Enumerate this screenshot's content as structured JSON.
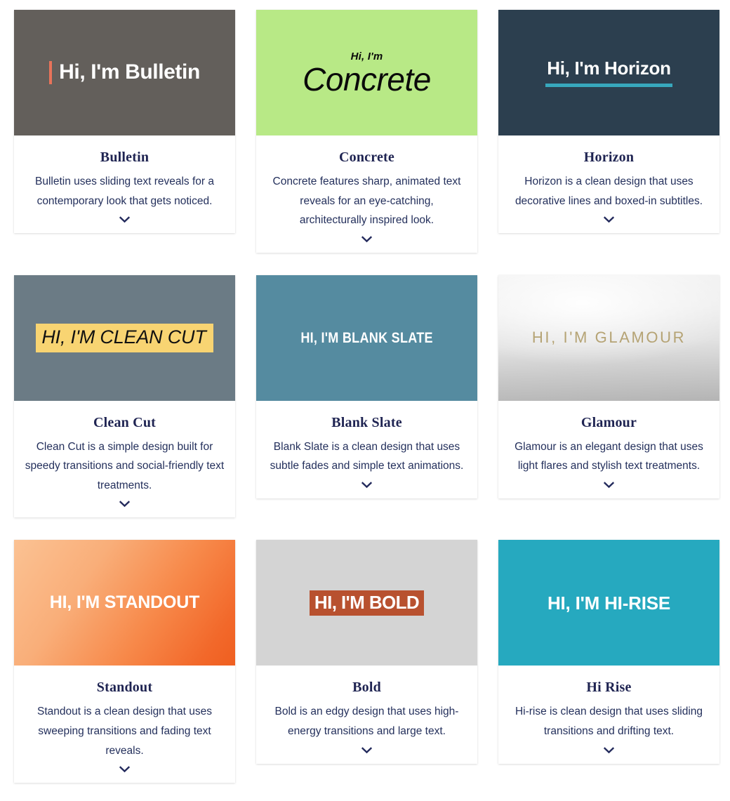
{
  "page": {
    "background_color": "#ffffff",
    "title_color": "#1f2452",
    "description_color": "#24305c"
  },
  "icons": {
    "expand_chevron": "chevron-down-icon"
  },
  "themes": [
    {
      "id": "bulletin",
      "preview_text": "Hi, I'm Bulletin",
      "preview_bg": "#635f5b",
      "preview_accent": "#e8735a",
      "title": "Bulletin",
      "description": "Bulletin uses sliding text reveals for a contemporary look that gets noticed."
    },
    {
      "id": "concrete",
      "preview_text_small": "Hi, I'm",
      "preview_text": "Concrete",
      "preview_bg": "#b8e986",
      "preview_accent": "#0a0a0a",
      "title": "Concrete",
      "description": "Concrete features sharp, animated text reveals for an eye-catching, architecturally inspired look."
    },
    {
      "id": "horizon",
      "preview_text": "Hi, I'm Horizon",
      "preview_bg": "#2c3f4f",
      "preview_accent": "#37a8bd",
      "title": "Horizon",
      "description": "Horizon is a clean design that uses decorative lines and boxed-in subtitles."
    },
    {
      "id": "clean-cut",
      "preview_text": "HI, I'M CLEAN CUT",
      "preview_bg": "#6b7b85",
      "preview_accent": "#f8d472",
      "title": "Clean Cut",
      "description": "Clean Cut is a simple design built for speedy transitions and social-friendly text treatments."
    },
    {
      "id": "blank-slate",
      "preview_text": "HI, I'M BLANK SLATE",
      "preview_bg": "#558ba0",
      "preview_accent": "#ffffff",
      "title": "Blank Slate",
      "description": "Blank Slate is a clean design that uses subtle fades and simple text animations."
    },
    {
      "id": "glamour",
      "preview_text": "HI, I'M GLAMOUR",
      "preview_bg": "#e4e4e4",
      "preview_accent": "#b5a374",
      "title": "Glamour",
      "description": "Glamour is an elegant design that uses light flares and stylish text treatments."
    },
    {
      "id": "standout",
      "preview_text": "HI, I'M STANDOUT",
      "preview_bg": "#f7894a",
      "preview_accent": "#ffffff",
      "title": "Standout",
      "description": "Standout is a clean design that uses sweeping transitions and fading text reveals."
    },
    {
      "id": "bold",
      "preview_text": "HI, I'M BOLD",
      "preview_bg": "#d4d4d4",
      "preview_accent": "#b8512f",
      "title": "Bold",
      "description": "Bold is an edgy design that uses high-energy transitions and large text."
    },
    {
      "id": "hi-rise",
      "preview_text": "HI, I'M HI-RISE",
      "preview_bg": "#26a9bf",
      "preview_accent": "#ffffff",
      "title": "Hi Rise",
      "description": "Hi-rise is clean design that uses sliding transitions and drifting text."
    }
  ]
}
